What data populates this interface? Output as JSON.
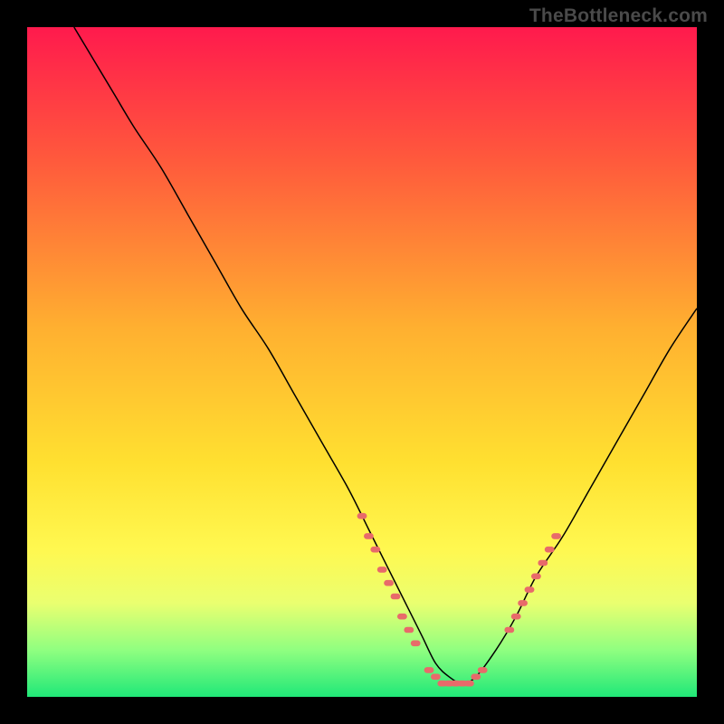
{
  "watermark": "TheBottleneck.com",
  "chart_data": {
    "type": "line",
    "title": "",
    "xlabel": "",
    "ylabel": "",
    "xlim": [
      0,
      100
    ],
    "ylim": [
      0,
      100
    ],
    "grid": false,
    "legend": false,
    "background": {
      "type": "vertical-gradient",
      "stops": [
        {
          "pos": 0.0,
          "color": "#ff1a4d"
        },
        {
          "pos": 0.2,
          "color": "#ff5a3c"
        },
        {
          "pos": 0.45,
          "color": "#ffb030"
        },
        {
          "pos": 0.65,
          "color": "#ffe030"
        },
        {
          "pos": 0.78,
          "color": "#fff850"
        },
        {
          "pos": 0.86,
          "color": "#eaff70"
        },
        {
          "pos": 0.93,
          "color": "#90ff80"
        },
        {
          "pos": 1.0,
          "color": "#20e878"
        }
      ]
    },
    "series": [
      {
        "name": "bottleneck-curve",
        "color": "#000000",
        "width": 1.5,
        "x": [
          7,
          10,
          13,
          16,
          20,
          24,
          28,
          32,
          36,
          40,
          44,
          48,
          51,
          54,
          57,
          59,
          61,
          63,
          65,
          67,
          70,
          73,
          76,
          80,
          84,
          88,
          92,
          96,
          100
        ],
        "y": [
          100,
          95,
          90,
          85,
          79,
          72,
          65,
          58,
          52,
          45,
          38,
          31,
          25,
          19,
          13,
          9,
          5,
          3,
          2,
          3,
          7,
          12,
          18,
          24,
          31,
          38,
          45,
          52,
          58
        ]
      },
      {
        "name": "highlight-left",
        "type": "scatter",
        "color": "#e86a6a",
        "size": 6,
        "shape": "rounded-dash",
        "x": [
          50,
          51,
          52,
          53,
          54,
          55,
          56,
          57,
          58
        ],
        "y": [
          27,
          24,
          22,
          19,
          17,
          15,
          12,
          10,
          8
        ]
      },
      {
        "name": "highlight-bottom",
        "type": "scatter",
        "color": "#e86a6a",
        "size": 6,
        "shape": "rounded-dash",
        "x": [
          60,
          61,
          62,
          63,
          64,
          65,
          66,
          67,
          68
        ],
        "y": [
          4,
          3,
          2,
          2,
          2,
          2,
          2,
          3,
          4
        ]
      },
      {
        "name": "highlight-right",
        "type": "scatter",
        "color": "#e86a6a",
        "size": 6,
        "shape": "rounded-dash",
        "x": [
          72,
          73,
          74,
          75,
          76,
          77,
          78,
          79
        ],
        "y": [
          10,
          12,
          14,
          16,
          18,
          20,
          22,
          24
        ]
      }
    ]
  }
}
